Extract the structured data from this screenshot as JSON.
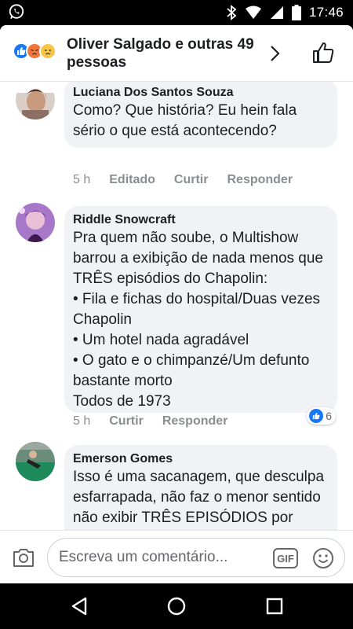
{
  "status_bar": {
    "time": "17:46"
  },
  "header": {
    "title": "Oliver Salgado e outras 49 pessoas",
    "reaction_icons": [
      "like",
      "angry",
      "sad"
    ]
  },
  "comments": [
    {
      "author": "Luciana Dos Santos Souza",
      "text": "Como? Que história?  Eu hein fala sério o que  está acontecendo?",
      "time": "5 h",
      "actions": [
        "Editado",
        "Curtir",
        "Responder"
      ]
    },
    {
      "author": "Riddle Snowcraft",
      "text": "Pra quem não soube, o Multishow barrou a exibição de nada menos que TRÊS episódios do Chapolin:\n• Fila e fichas do hospital/Duas vezes Chapolin\n• Um hotel nada agradável\n• O gato e o chimpanzé/Um defunto bastante morto\nTodos de 1973",
      "time": "5 h",
      "actions": [
        "Curtir",
        "Responder"
      ],
      "reaction_count": "6"
    },
    {
      "author": "Emerson Gomes",
      "text": "Isso é uma sacanagem, que desculpa esfarrapada, não faz o menor sentido não exibir TRÊS EPISÓDIOS por PROBLEMAS TÉCNICOS!!! Eu quero que o"
    }
  ],
  "composer": {
    "placeholder": "Escreva um comentário...",
    "gif_label": "GIF"
  },
  "colors": {
    "facebook_blue": "#1877f2",
    "bubble_gray": "#f0f2f5",
    "meta_gray": "#8a8d91"
  }
}
